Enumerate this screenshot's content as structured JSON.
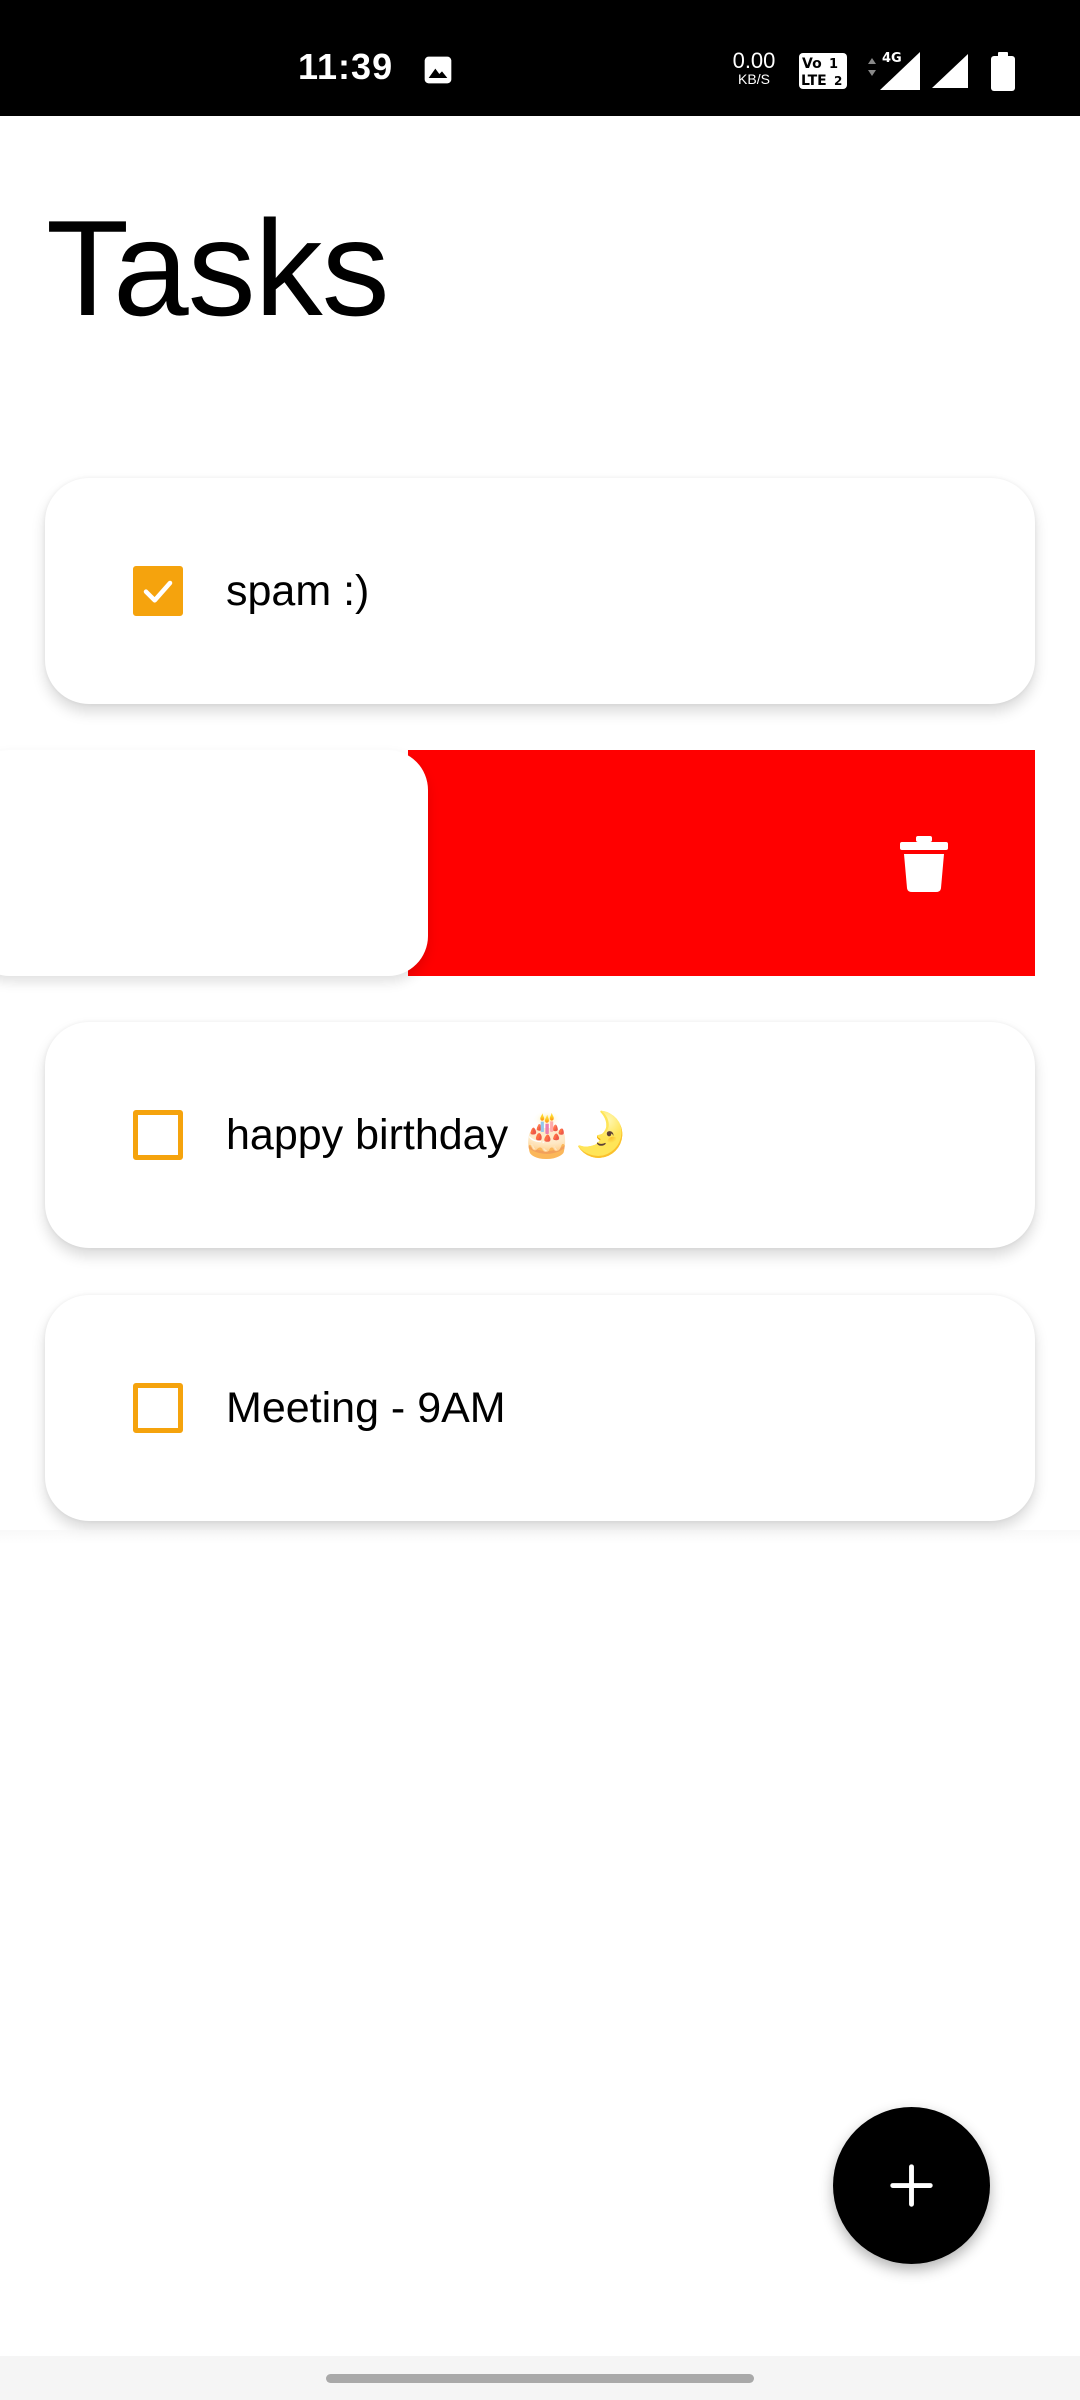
{
  "status_bar": {
    "time": "11:39",
    "net_speed_value": "0.00",
    "net_speed_unit": "KB/S",
    "network": "4G",
    "icons": [
      "gallery-icon",
      "volte-icon",
      "signal-icon",
      "signal-icon",
      "battery-icon"
    ]
  },
  "page": {
    "title": "Tasks"
  },
  "tasks": [
    {
      "text": "spam :)",
      "checked": true
    },
    {
      "text": "happy birthday 🎂🌛",
      "checked": false
    },
    {
      "text": "Meeting - 9AM",
      "checked": false
    }
  ],
  "colors": {
    "accent": "#f5a30d",
    "delete": "#ff0000",
    "fab": "#000000"
  },
  "fab": {
    "icon": "plus-icon"
  },
  "swipe_action": {
    "icon": "trash-icon"
  }
}
